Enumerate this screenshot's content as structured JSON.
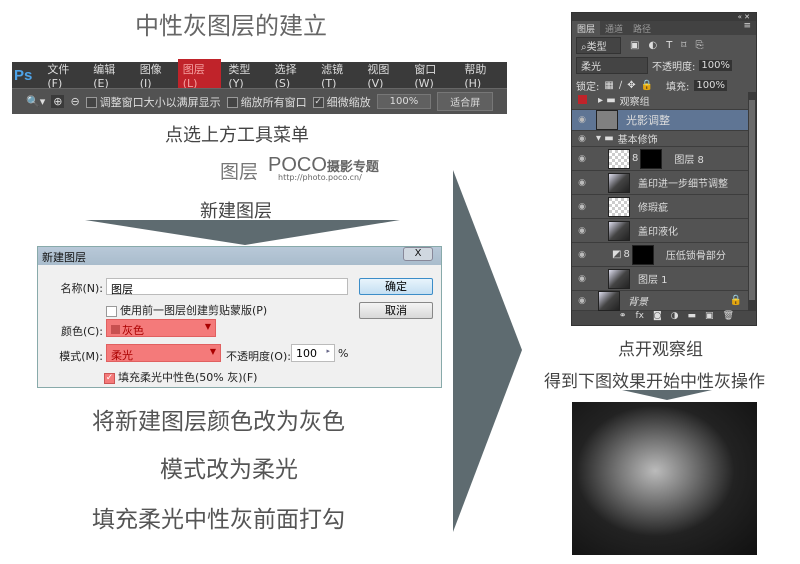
{
  "title": "中性灰图层的建立",
  "menu": {
    "logo": "Ps",
    "items": [
      "文件(F)",
      "编辑(E)",
      "图像(I)",
      "图层(L)",
      "类型(Y)",
      "选择(S)",
      "滤镜(T)",
      "视图(V)",
      "窗口(W)",
      "帮助(H)"
    ],
    "active": "图层(L)"
  },
  "toolbar": {
    "resize_windows": "调整窗口大小以满屏显示",
    "zoom_all": "缩放所有窗口",
    "scrubby": "细微缩放",
    "zoom_value": "100%",
    "fit": "适合屏"
  },
  "captions": {
    "step1": "点选上方工具菜单",
    "step2_menu": "图层",
    "watermark_brand": "POCO",
    "watermark_text": "摄影专题",
    "watermark_url": "http://photo.poco.cn/",
    "step3": "新建图层",
    "c1": "将新建图层颜色改为灰色",
    "c2": "模式改为柔光",
    "c3": "填充柔光中性灰前面打勾",
    "r1": "点开观察组",
    "r2": "得到下图效果开始中性灰操作"
  },
  "dialog": {
    "title": "新建图层",
    "close": "X",
    "name_label": "名称(N):",
    "name_value": "图层",
    "clip_label": "使用前一图层创建剪贴蒙版(P)",
    "color_label": "颜色(C):",
    "color_value": "灰色",
    "mode_label": "模式(M):",
    "mode_value": "柔光",
    "opacity_label": "不透明度(O):",
    "opacity_value": "100",
    "opacity_unit": "%",
    "fill_label": "填充柔光中性色(50% 灰)(F)",
    "ok": "确定",
    "cancel": "取消",
    "highlight_color": "#f47a7a"
  },
  "layers_panel": {
    "tabs": [
      "图层",
      "通道",
      "路径"
    ],
    "filter": "类型",
    "blend": "柔光",
    "opacity_label": "不透明度:",
    "opacity": "100%",
    "lock_label": "锁定:",
    "fill_label": "填充:",
    "fill": "100%",
    "layers": [
      "观察组",
      "光影调整",
      "基本修饰",
      "图层 8",
      "盖印进一步细节调整",
      "修瑕疵",
      "盖印液化",
      "压低锁骨部分",
      "图层 1",
      "背景"
    ]
  },
  "colors": {
    "arrow": "#5e6b70",
    "selected_layer": "#5f7594",
    "menu_active": "#c0232a"
  }
}
